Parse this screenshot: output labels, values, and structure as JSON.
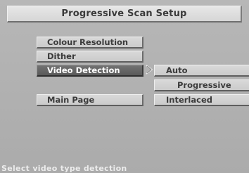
{
  "title": "Progressive Scan Setup",
  "menu": {
    "items": [
      {
        "label": "Colour Resolution"
      },
      {
        "label": "Dither"
      },
      {
        "label": "Video Detection"
      },
      {
        "label": "Main Page"
      }
    ],
    "selected": "Video Detection"
  },
  "submenu": {
    "options": [
      {
        "label": "Auto"
      },
      {
        "label": "Progressive"
      },
      {
        "label": "Interlaced"
      }
    ]
  },
  "hint": "Select video type detection",
  "colors": {
    "background": "#b3b3b3",
    "button_face": "#d2d2d2",
    "selected_face": "#666666",
    "hint_text": "#ececec"
  }
}
